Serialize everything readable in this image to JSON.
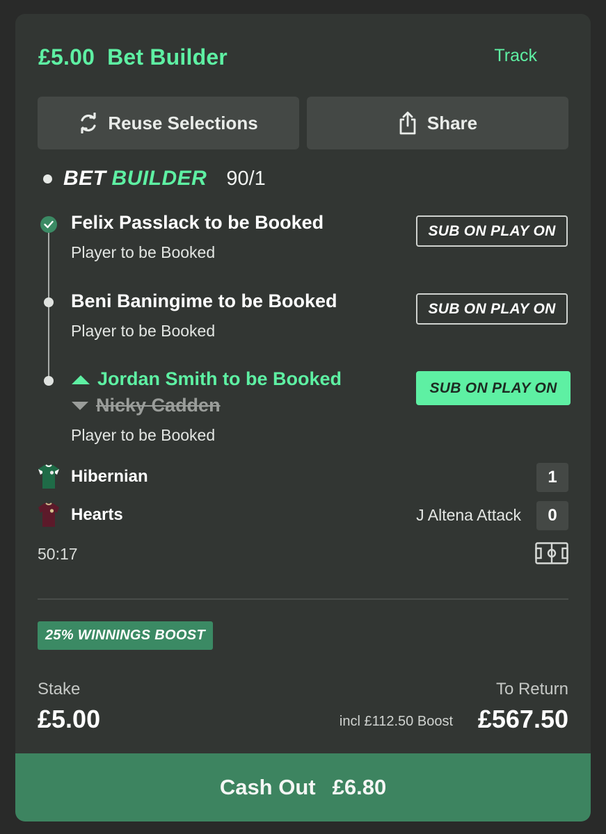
{
  "header": {
    "amount": "£5.00",
    "title": "Bet Builder",
    "track_label": "Track"
  },
  "actions": {
    "reuse_label": "Reuse Selections",
    "share_label": "Share"
  },
  "bet_builder": {
    "logo_left": "BET",
    "logo_right": "BUILDER",
    "odds": "90/1"
  },
  "legs": [
    {
      "title": "Felix Passlack to be Booked",
      "market": "Player to be Booked",
      "status": "won",
      "tag": "SUB ON PLAY ON"
    },
    {
      "title": "Beni Baningime to be Booked",
      "market": "Player to be Booked",
      "status": "open",
      "tag": "SUB ON PLAY ON"
    },
    {
      "title": "Jordan Smith to be Booked",
      "replaced": "Nicky Cadden",
      "market": "Player to be Booked",
      "status": "substituted",
      "tag": "SUB ON PLAY ON"
    }
  ],
  "match": {
    "home_team": "Hibernian",
    "home_score": "1",
    "away_team": "Hearts",
    "away_score": "0",
    "event_text": "J Altena Attack",
    "clock": "50:17"
  },
  "boost": {
    "badge": "25% WINNINGS BOOST",
    "incl_text": "incl £112.50 Boost"
  },
  "stake": {
    "label": "Stake",
    "value": "£5.00"
  },
  "to_return": {
    "label": "To Return",
    "value": "£567.50"
  },
  "cashout": {
    "label": "Cash Out",
    "amount": "£6.80"
  },
  "colors": {
    "accent": "#5ef0a3",
    "card": "#323633",
    "button": "#444845",
    "cashout": "#3d8460",
    "badge": "#3b8a64"
  },
  "icons": [
    "refresh-icon",
    "share-icon",
    "check-icon",
    "arrow-up-icon",
    "arrow-down-icon",
    "hibernian-shirt-icon",
    "hearts-shirt-icon",
    "pitch-icon"
  ]
}
